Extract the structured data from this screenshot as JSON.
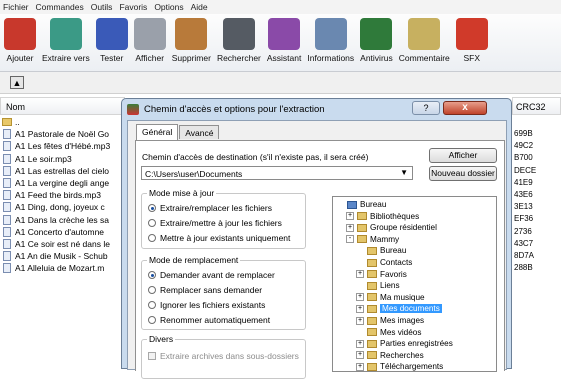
{
  "menu": [
    "Fichier",
    "Commandes",
    "Outils",
    "Favoris",
    "Options",
    "Aide"
  ],
  "toolbar": [
    {
      "label": "Ajouter",
      "icon": "add-archive-icon",
      "color": "#c8382c"
    },
    {
      "label": "Extraire vers",
      "icon": "extract-folder-icon",
      "color": "#3b9a86"
    },
    {
      "label": "Tester",
      "icon": "test-icon",
      "color": "#3a5ab8"
    },
    {
      "label": "Afficher",
      "icon": "view-icon",
      "color": "#9aa0aa"
    },
    {
      "label": "Supprimer",
      "icon": "delete-icon",
      "color": "#b87a3a"
    },
    {
      "label": "Rechercher",
      "icon": "binoculars-icon",
      "color": "#555b63"
    },
    {
      "label": "Assistant",
      "icon": "wizard-icon",
      "color": "#8a4aa8"
    },
    {
      "label": "Informations",
      "icon": "info-icon",
      "color": "#6a88b0"
    },
    {
      "label": "Antivirus",
      "icon": "antivirus-icon",
      "color": "#2f7a3a"
    },
    {
      "label": "Commentaire",
      "icon": "comment-icon",
      "color": "#c7b060"
    },
    {
      "label": "SFX",
      "icon": "sfx-icon",
      "color": "#d03a2a"
    }
  ],
  "filelist": {
    "header": "Nom",
    "crc_header": "CRC32",
    "rows": [
      {
        "name": "..",
        "folder": true,
        "crc": ""
      },
      {
        "name": "A1 Pastorale de Noël Go",
        "crc": "699B"
      },
      {
        "name": "A1 Les fêtes d'Hébé.mp3",
        "crc": "49C2"
      },
      {
        "name": "A1 Le soir.mp3",
        "crc": "B700"
      },
      {
        "name": "A1 Las estrellas del cielo",
        "crc": "DECE"
      },
      {
        "name": "A1 La vergine degli ange",
        "crc": "41E9"
      },
      {
        "name": "A1 Feed the birds.mp3",
        "crc": "43E6"
      },
      {
        "name": "A1 Ding, dong, joyeux c",
        "crc": "3E13"
      },
      {
        "name": "A1 Dans la crèche les sa",
        "crc": "EF36"
      },
      {
        "name": "A1 Concerto d'automne",
        "crc": "2736"
      },
      {
        "name": "A1 Ce soir est né dans le",
        "crc": "43C7"
      },
      {
        "name": "A1 An die Musik - Schub",
        "crc": "8D7A"
      },
      {
        "name": "A1 Alleluia de Mozart.m",
        "crc": "288B"
      }
    ]
  },
  "dialog": {
    "title": "Chemin d'accès et options pour l'extraction",
    "help": "?",
    "close": "x",
    "tabs": [
      "Général",
      "Avancé"
    ],
    "dest_label": "Chemin d'accès de destination (s'il n'existe pas, il sera créé)",
    "dest_value": "C:\\Users\\user\\Documents",
    "show_button": "Afficher",
    "new_folder_button": "Nouveau dossier",
    "update_group": {
      "title": "Mode mise à jour",
      "options": [
        "Extraire/remplacer les fichiers",
        "Extraire/mettre à jour les fichiers",
        "Mettre à jour existants uniquement"
      ],
      "selected": 0
    },
    "replace_group": {
      "title": "Mode de remplacement",
      "options": [
        "Demander avant de remplacer",
        "Remplacer sans demander",
        "Ignorer les fichiers existants",
        "Renommer automatiquement"
      ],
      "selected": 0
    },
    "misc_group": {
      "title": "Divers",
      "options": [
        "Extraire archives dans sous-dossiers"
      ]
    },
    "tree": [
      {
        "label": "Bureau",
        "level": 0,
        "toggle": "",
        "blue": true
      },
      {
        "label": "Bibliothèques",
        "level": 1,
        "toggle": "+"
      },
      {
        "label": "Groupe résidentiel",
        "level": 1,
        "toggle": "+"
      },
      {
        "label": "Mammy",
        "level": 1,
        "toggle": "-"
      },
      {
        "label": "Bureau",
        "level": 2,
        "toggle": ""
      },
      {
        "label": "Contacts",
        "level": 2,
        "toggle": ""
      },
      {
        "label": "Favoris",
        "level": 2,
        "toggle": "+"
      },
      {
        "label": "Liens",
        "level": 2,
        "toggle": ""
      },
      {
        "label": "Ma musique",
        "level": 2,
        "toggle": "+"
      },
      {
        "label": "Mes documents",
        "level": 2,
        "toggle": "+",
        "selected": true
      },
      {
        "label": "Mes images",
        "level": 2,
        "toggle": "+"
      },
      {
        "label": "Mes vidéos",
        "level": 2,
        "toggle": ""
      },
      {
        "label": "Parties enregistrées",
        "level": 2,
        "toggle": "+"
      },
      {
        "label": "Recherches",
        "level": 2,
        "toggle": "+"
      },
      {
        "label": "Téléchargements",
        "level": 2,
        "toggle": "+"
      }
    ]
  }
}
